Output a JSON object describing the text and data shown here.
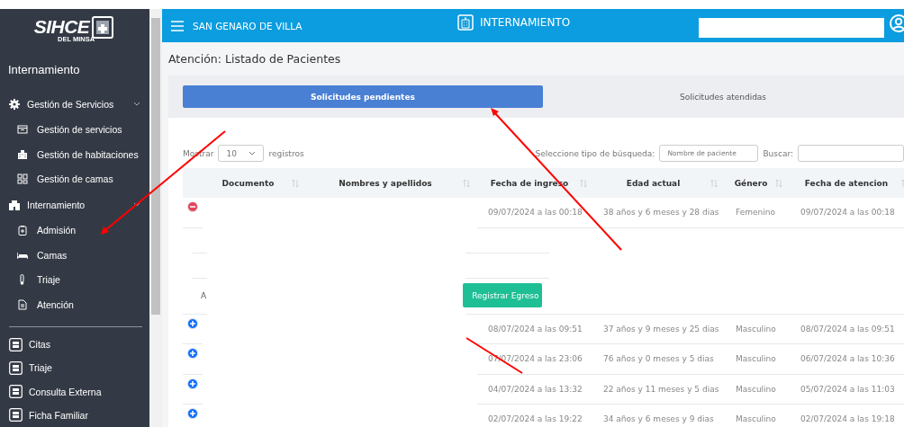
{
  "sidebar": {
    "logo": {
      "name": "SIHCE",
      "subtitle": "DEL MINSA"
    },
    "title": "Internamiento",
    "groups": [
      {
        "label": "Gestión de Servicios",
        "expanded": true,
        "children": [
          {
            "label": "Gestión de servicios"
          },
          {
            "label": "Gestión de habitaciones"
          },
          {
            "label": "Gestión de camas"
          }
        ]
      },
      {
        "label": "Internamiento",
        "expanded": true,
        "children": [
          {
            "label": "Admisión"
          },
          {
            "label": "Camas"
          },
          {
            "label": "Triaje"
          },
          {
            "label": "Atención"
          }
        ]
      }
    ],
    "items": [
      {
        "label": "Citas"
      },
      {
        "label": "Triaje"
      },
      {
        "label": "Consulta Externa"
      },
      {
        "label": "Ficha Familiar"
      }
    ]
  },
  "header": {
    "facility": "SAN GENARO DE VILLA",
    "module": "INTERNAMIENTO"
  },
  "page_title": "Atención: Listado de Pacientes",
  "tabs": [
    {
      "label": "Solicitudes pendientes",
      "selected": true
    },
    {
      "label": "Solicitudes atendidas",
      "selected": false
    }
  ],
  "controls": {
    "show_label": "Mostrar",
    "page_size": "10",
    "records_label": "registros",
    "search_type_label": "Seleccione tipo de búsqueda:",
    "search_type": "Nombre de paciente",
    "search_label": "Buscar:"
  },
  "table": {
    "columns": [
      "Documento",
      "Nombres y apellidos",
      "Fecha de ingreso",
      "Edad actual",
      "Género",
      "Fecha de atencion"
    ],
    "rows": [
      {
        "expanded": true,
        "admission": "09/07/2024 a las 00:18",
        "age": "38 años y 6 meses y 28 dias",
        "gender": "Femenino",
        "attention": "09/07/2024 a las 00:18",
        "detail": {
          "label": "A",
          "button": "Registrar Egreso"
        }
      },
      {
        "expanded": false,
        "admission": "08/07/2024 a las 09:51",
        "age": "37 años y 9 meses y 25 dias",
        "gender": "Masculino",
        "attention": "08/07/2024 a las 09:51"
      },
      {
        "expanded": false,
        "admission": "07/07/2024 a las 23:06",
        "age": "76 años y 0 meses y 5 dias",
        "gender": "Masculino",
        "attention": "06/07/2024 a las 10:36"
      },
      {
        "expanded": false,
        "admission": "04/07/2024 a las 13:32",
        "age": "22 años y 11 meses y 5 dias",
        "gender": "Masculino",
        "attention": "05/07/2024 a las 11:03"
      },
      {
        "expanded": false,
        "admission": "02/07/2024 a las 19:22",
        "age": "34 años y 6 meses y 9 dias",
        "gender": "Masculino",
        "attention": "02/07/2024 a las 19:18"
      }
    ]
  }
}
